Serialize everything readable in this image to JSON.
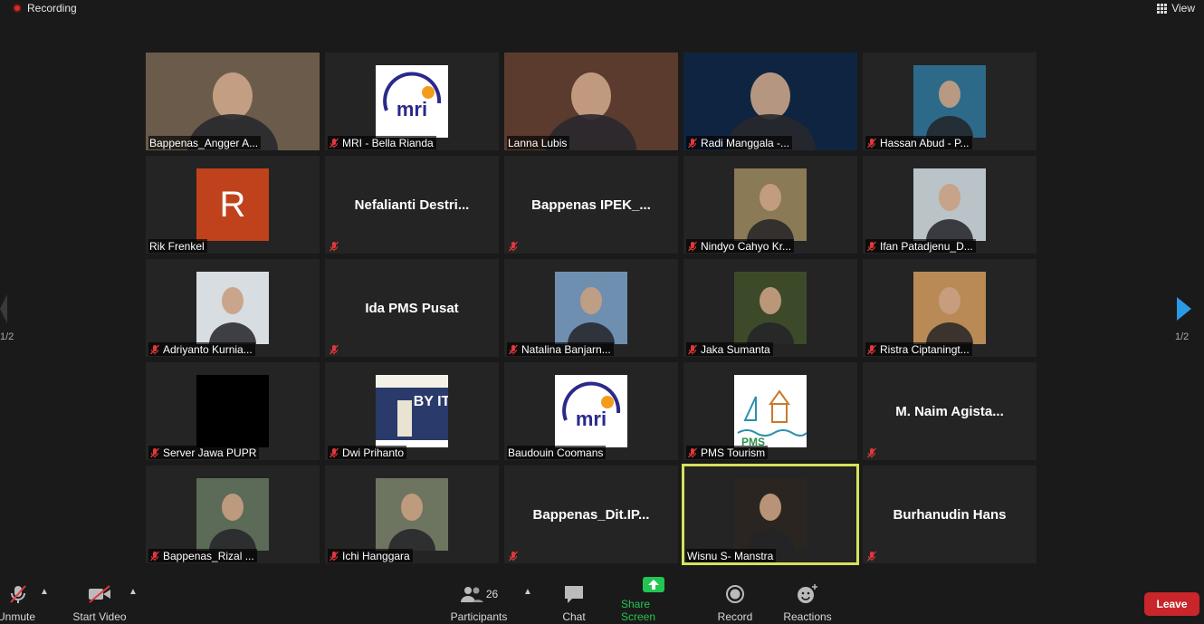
{
  "top": {
    "recording_label": "Recording",
    "view_label": "View"
  },
  "pagination": {
    "left": "1/2",
    "right": "1/2"
  },
  "participants": [
    {
      "name": "Bappenas_Angger A...",
      "muted": false,
      "kind": "video",
      "bg": "#6b5b4b"
    },
    {
      "name": "MRI - Bella Rianda",
      "muted": true,
      "kind": "mri"
    },
    {
      "name": "Lanna Lubis",
      "muted": false,
      "kind": "video",
      "bg": "#5a3b2e"
    },
    {
      "name": "Radi Manggala -...",
      "muted": true,
      "kind": "video",
      "bg": "#0f2440"
    },
    {
      "name": "Hassan Abud - P...",
      "muted": true,
      "kind": "thumb",
      "bg": "#2d6a8a"
    },
    {
      "name": "Rik Frenkel",
      "muted": false,
      "kind": "letter",
      "letter": "R",
      "bg": "#c0421c"
    },
    {
      "name": "",
      "muted": true,
      "kind": "text",
      "big": "Nefalianti  Destri..."
    },
    {
      "name": "",
      "muted": true,
      "kind": "text",
      "big": "Bappenas  IPEK_..."
    },
    {
      "name": "Nindyo Cahyo Kr...",
      "muted": true,
      "kind": "thumb",
      "bg": "#8a7a55"
    },
    {
      "name": "Ifan Patadjenu_D...",
      "muted": true,
      "kind": "thumb",
      "bg": "#b9c3c8"
    },
    {
      "name": "Adriyanto Kurnia...",
      "muted": true,
      "kind": "thumb",
      "bg": "#d7dde0"
    },
    {
      "name": "",
      "muted": true,
      "kind": "text",
      "big": "Ida PMS Pusat"
    },
    {
      "name": "Natalina Banjarn...",
      "muted": true,
      "kind": "thumb",
      "bg": "#6f8fb0"
    },
    {
      "name": "Jaka Sumanta",
      "muted": true,
      "kind": "thumb",
      "bg": "#3d4a2a"
    },
    {
      "name": "Ristra Ciptaningt...",
      "muted": true,
      "kind": "thumb",
      "bg": "#b98a55"
    },
    {
      "name": "Server Jawa PUPR",
      "muted": true,
      "kind": "thumb",
      "bg": "#000000"
    },
    {
      "name": "Dwi Prihanto",
      "muted": true,
      "kind": "byt",
      "bg": "#2a3a6a"
    },
    {
      "name": "Baudouin Coomans",
      "muted": false,
      "kind": "mri"
    },
    {
      "name": "PMS Tourism",
      "muted": true,
      "kind": "pms"
    },
    {
      "name": "",
      "muted": true,
      "kind": "text",
      "big": "M. Naim Agista..."
    },
    {
      "name": "Bappenas_Rizal ...",
      "muted": true,
      "kind": "thumb",
      "bg": "#5c6a58"
    },
    {
      "name": "Ichi Hanggara",
      "muted": true,
      "kind": "thumb",
      "bg": "#6d7560"
    },
    {
      "name": "",
      "muted": true,
      "kind": "text",
      "big": "Bappenas_Dit.IP..."
    },
    {
      "name": "Wisnu S- Manstra",
      "muted": false,
      "kind": "thumb",
      "bg": "#2a2520",
      "active": true
    },
    {
      "name": "",
      "muted": true,
      "kind": "text",
      "big": "Burhanudin Hans"
    }
  ],
  "logos": {
    "mri": "mri",
    "byt": "BY IT",
    "pms": "PMS"
  },
  "toolbar": {
    "unmute": "Unmute",
    "start_video": "Start Video",
    "participants": "Participants",
    "participants_count": "26",
    "chat": "Chat",
    "share": "Share Screen",
    "record": "Record",
    "reactions": "Reactions",
    "leave": "Leave"
  },
  "colors": {
    "accent_share": "#23c552",
    "active_border": "#d5e25a",
    "leave": "#c8262a",
    "muted_icon": "#e0383c"
  }
}
